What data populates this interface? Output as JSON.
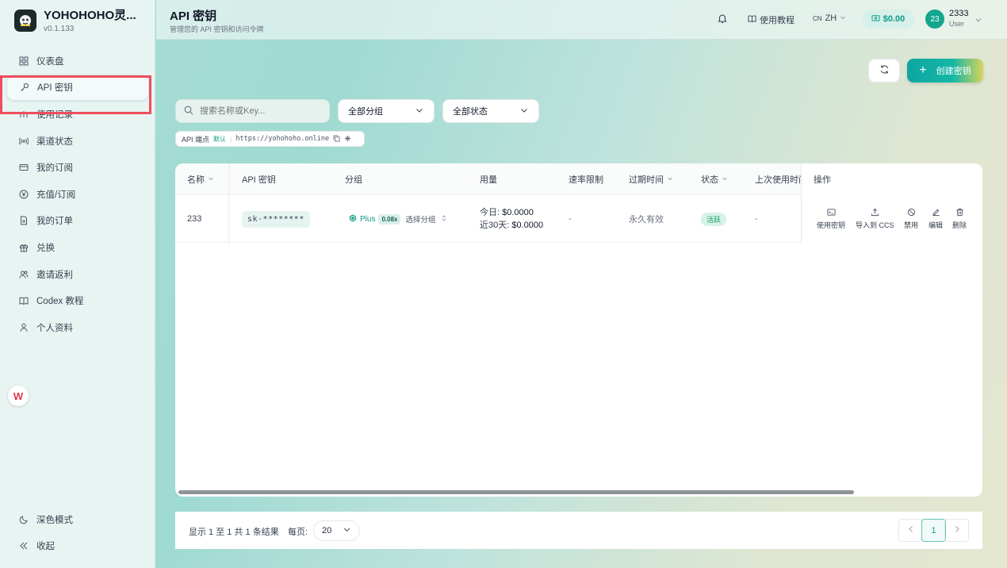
{
  "app": {
    "name": "YOHOHOHO灵...",
    "version": "v0.1.133"
  },
  "sidebar": {
    "items": [
      {
        "label": "仪表盘",
        "icon": "dashboard-icon"
      },
      {
        "label": "API 密钥",
        "icon": "key-icon",
        "active": true
      },
      {
        "label": "使用记录",
        "icon": "chart-icon"
      },
      {
        "label": "渠道状态",
        "icon": "signal-icon"
      },
      {
        "label": "我的订阅",
        "icon": "card-icon"
      },
      {
        "label": "充值/订阅",
        "icon": "yen-icon"
      },
      {
        "label": "我的订单",
        "icon": "document-icon"
      },
      {
        "label": "兑换",
        "icon": "gift-icon"
      },
      {
        "label": "邀请返利",
        "icon": "users-icon"
      },
      {
        "label": "Codex 教程",
        "icon": "book-icon"
      },
      {
        "label": "个人资料",
        "icon": "user-icon"
      }
    ],
    "dark_mode_label": "深色模式",
    "collapse_label": "收起",
    "badge_letter": "W"
  },
  "header": {
    "title": "API 密钥",
    "subtitle": "管理您的 API 密钥和访问令牌",
    "guide_label": "使用教程",
    "lang_code": "CN",
    "lang_label": "ZH",
    "balance": "$0.00",
    "avatar_text": "23",
    "username": "2333",
    "role": "User"
  },
  "toolbar": {
    "create_label": "创建密钥",
    "search_placeholder": "搜索名称或Key...",
    "group_filter": "全部分组",
    "status_filter": "全部状态"
  },
  "endpoint": {
    "label": "API 端点",
    "default_tag": "默认",
    "url": "https://yohohoho.online"
  },
  "table": {
    "columns": [
      "名称",
      "API 密钥",
      "分组",
      "用量",
      "速率限制",
      "过期时间",
      "状态",
      "上次使用时间",
      "操作"
    ],
    "rows": [
      {
        "name": "233",
        "key": "sk-********",
        "group_name": "Plus",
        "group_mult": "0.08x",
        "group_select": "选择分组",
        "usage_today_label": "今日:",
        "usage_today": "$0.0000",
        "usage_30d_label": "近30天:",
        "usage_30d": "$0.0000",
        "rate_limit": "-",
        "expiry": "永久有效",
        "status": "活跃",
        "last_used": "-"
      }
    ],
    "actions": [
      "使用密钥",
      "导入到 CCS",
      "禁用",
      "编辑",
      "删除"
    ]
  },
  "footer": {
    "summary": "显示 1 至 1 共 1 条结果",
    "per_page_label": "每页:",
    "per_page_value": "20",
    "current_page": "1"
  },
  "colors": {
    "accent": "#14a58e",
    "highlight": "#f04d5e"
  }
}
